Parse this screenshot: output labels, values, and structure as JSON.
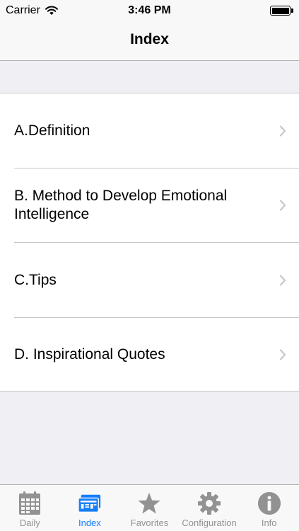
{
  "status_bar": {
    "carrier": "Carrier",
    "time": "3:46 PM"
  },
  "nav": {
    "title": "Index"
  },
  "list": {
    "items": [
      {
        "label": "A.Definition"
      },
      {
        "label": "B. Method to Develop Emotional Intelligence"
      },
      {
        "label": "C.Tips"
      },
      {
        "label": "D. Inspirational Quotes"
      }
    ]
  },
  "tab_bar": {
    "tabs": [
      {
        "label": "Daily",
        "icon": "calendar-icon"
      },
      {
        "label": "Index",
        "icon": "index-cards-icon",
        "active": true
      },
      {
        "label": "Favorites",
        "icon": "star-icon"
      },
      {
        "label": "Configuration",
        "icon": "gear-icon"
      },
      {
        "label": "Info",
        "icon": "info-icon"
      }
    ]
  },
  "colors": {
    "accent": "#157efb",
    "inactive": "#929292",
    "background": "#efeff4"
  }
}
